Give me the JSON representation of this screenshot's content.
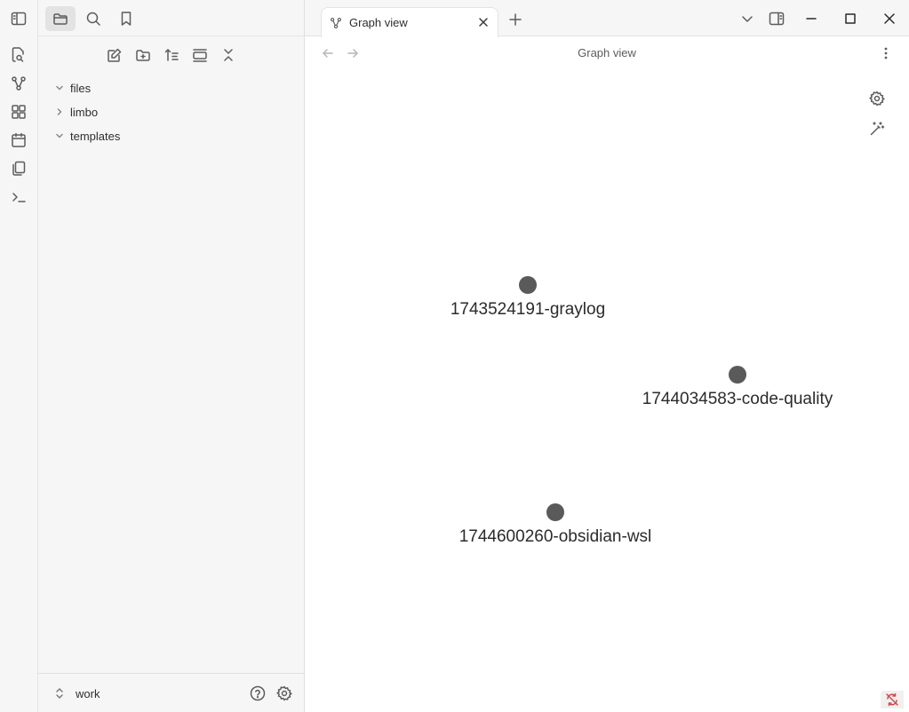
{
  "ribbon": {
    "items": [
      {
        "icon": "open-quick-switcher-icon"
      },
      {
        "icon": "graph-icon"
      },
      {
        "icon": "canvas-icon"
      },
      {
        "icon": "daily-note-icon"
      },
      {
        "icon": "templates-icon"
      },
      {
        "icon": "command-palette-icon"
      }
    ]
  },
  "sidebar": {
    "tabs": [
      {
        "icon": "files-icon",
        "active": true
      },
      {
        "icon": "search-icon",
        "active": false
      },
      {
        "icon": "bookmark-icon",
        "active": false
      }
    ],
    "tree": [
      {
        "label": "files",
        "expanded": true
      },
      {
        "label": "limbo",
        "expanded": false
      },
      {
        "label": "templates",
        "expanded": true
      }
    ],
    "vault": {
      "name": "work"
    }
  },
  "tabs": [
    {
      "label": "Graph view",
      "icon": "graph-icon",
      "active": true
    }
  ],
  "view": {
    "title": "Graph view"
  },
  "graph": {
    "node_color": "#5a5a5a",
    "nodes": [
      {
        "label": "1743524191-graylog"
      },
      {
        "label": "1744034583-code-quality"
      },
      {
        "label": "1744600260-obsidian-wsl"
      }
    ]
  },
  "colors": {
    "status_error": "#d04a4a"
  }
}
